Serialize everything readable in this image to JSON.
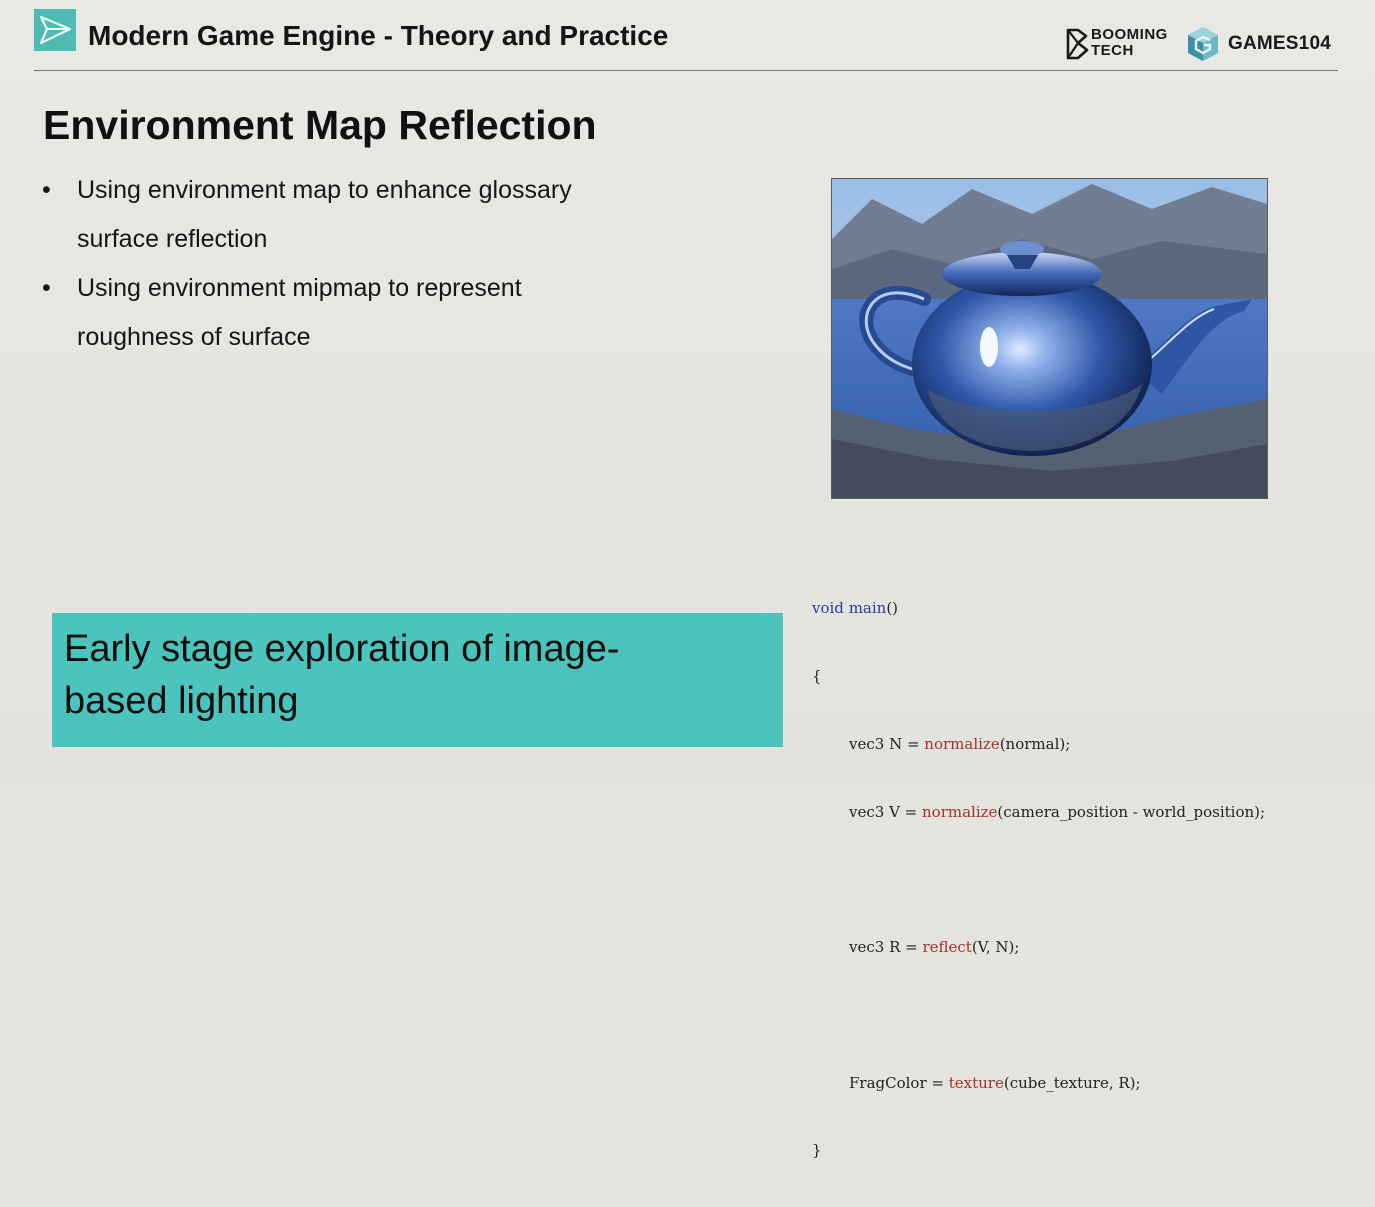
{
  "header": {
    "title": "Modern Game Engine - Theory and Practice",
    "brand_booming_line1": "BOOMING",
    "brand_booming_line2": "TECH",
    "brand_games": "GAMES104"
  },
  "slide": {
    "title": "Environment Map Reflection",
    "bullets": [
      {
        "marker": "•",
        "line1": "Using environment map to enhance glossary",
        "line2": "surface reflection"
      },
      {
        "marker": "•",
        "line1": "Using environment mipmap to represent",
        "line2": "roughness of surface"
      }
    ],
    "callout": {
      "line1": "Early stage exploration of image-",
      "line2": "based lighting"
    },
    "code": {
      "l1_kw": "void",
      "l1_fn": "main",
      "l1_rest": "()",
      "l2": "{",
      "l3_pre": "vec3 N = ",
      "l3_fn": "normalize",
      "l3_post": "(normal);",
      "l4_pre": "vec3 V = ",
      "l4_fn": "normalize",
      "l4_post": "(camera_position - world_position);",
      "l6_pre": "vec3 R = ",
      "l6_fn": "reflect",
      "l6_post": "(V, N);",
      "l8_pre": "FragColor = ",
      "l8_fn": "texture",
      "l8_post": "(cube_texture, R);",
      "l9": "}"
    }
  },
  "colors": {
    "accent_teal": "#4dbbb1",
    "callout_bg": "#4cc4be",
    "code_keyword": "#2b3b9e",
    "code_function": "#a3312c"
  },
  "icons": {
    "logo": "paper-plane-icon",
    "booming": "b-hexagon-logo-icon",
    "games": "g-cube-logo-icon"
  }
}
